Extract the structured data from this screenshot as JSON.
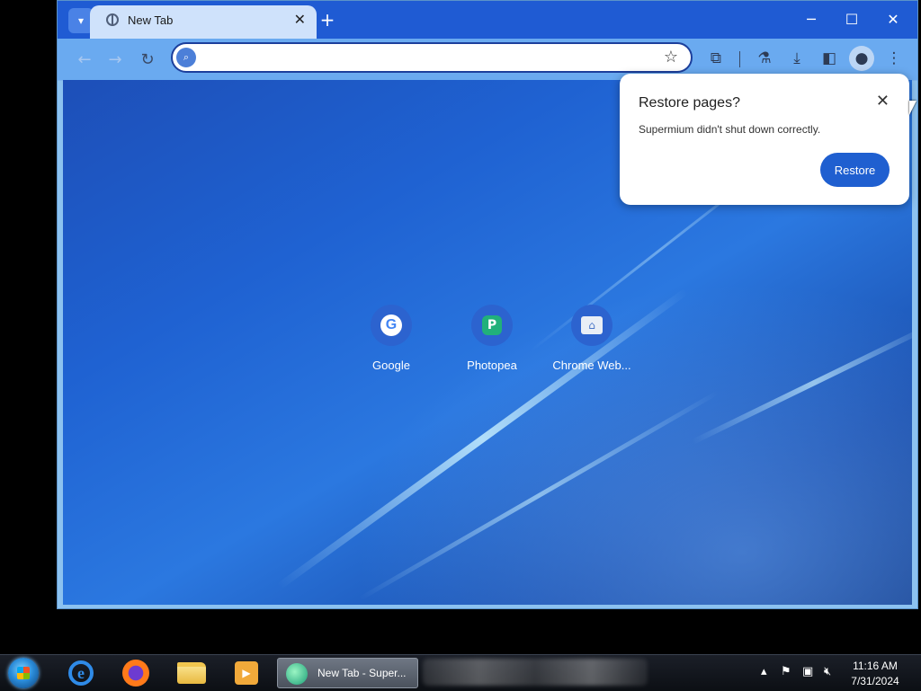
{
  "browser": {
    "tab": {
      "title": "New Tab",
      "close_label": "✕"
    },
    "newtab_label": "+",
    "window_controls": {
      "minimize": "─",
      "maximize": "☐",
      "close": "✕"
    },
    "omnibox": {
      "value": "",
      "placeholder": ""
    },
    "icons": [
      "search-icon",
      "back-arrow-icon",
      "forward-arrow-icon",
      "reload-icon",
      "star-icon",
      "extensions-icon",
      "labs-icon",
      "download-icon",
      "side-panel-icon",
      "profile-icon",
      "menu-dots-icon"
    ]
  },
  "shortcuts": [
    {
      "label": "Google"
    },
    {
      "label": "Photopea"
    },
    {
      "label": "Chrome Web..."
    }
  ],
  "restore_dialog": {
    "title": "Restore pages?",
    "message": "Supermium didn't shut down correctly.",
    "button": "Restore",
    "close": "✕"
  },
  "taskbar": {
    "active_window": "New Tab - Super...",
    "clock": {
      "time": "11:16 AM",
      "date": "7/31/2024"
    }
  },
  "colors": {
    "titlebar": "#1f5bd3",
    "toolbar": "#6aaaf0",
    "accent_button": "#1f5fd0"
  }
}
